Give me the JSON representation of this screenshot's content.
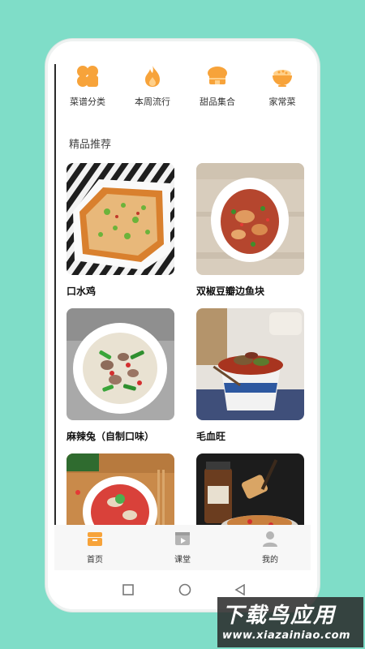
{
  "categories": [
    {
      "label": "菜谱分类",
      "icon": "grid-petals-icon"
    },
    {
      "label": "本周流行",
      "icon": "flame-icon"
    },
    {
      "label": "甜品集合",
      "icon": "cake-icon"
    },
    {
      "label": "家常菜",
      "icon": "rice-bowl-icon"
    }
  ],
  "section": {
    "title": "精品推荐"
  },
  "recipes": [
    {
      "title": "口水鸡"
    },
    {
      "title": "双椒豆瓣边鱼块"
    },
    {
      "title": "麻辣兔（自制口味）"
    },
    {
      "title": "毛血旺"
    },
    {
      "title": ""
    },
    {
      "title": ""
    }
  ],
  "tabs": [
    {
      "label": "首页",
      "icon": "home-icon",
      "active": true
    },
    {
      "label": "课堂",
      "icon": "video-icon",
      "active": false
    },
    {
      "label": "我的",
      "icon": "user-icon",
      "active": false
    }
  ],
  "colors": {
    "accent": "#f7a33a",
    "background": "#7fddc8"
  },
  "watermark": {
    "big": "下载鸟应用",
    "small": "www.xiazainiao.com"
  }
}
